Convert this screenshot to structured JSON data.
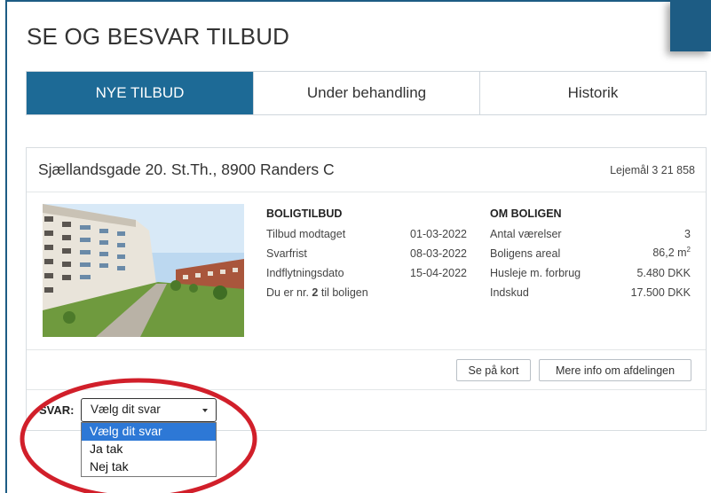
{
  "page": {
    "title": "SE OG BESVAR TILBUD"
  },
  "tabs": [
    {
      "label": "NYE TILBUD",
      "active": true
    },
    {
      "label": "Under behandling",
      "active": false
    },
    {
      "label": "Historik",
      "active": false
    }
  ],
  "offer": {
    "address": "Sjællandsgade 20. St.Th., 8900 Randers C",
    "lease_number": "Lejemål 3 21 858",
    "boligtilbud": {
      "title": "BOLIGTILBUD",
      "rows": [
        {
          "label": "Tilbud modtaget",
          "value": "01-03-2022"
        },
        {
          "label": "Svarfrist",
          "value": "08-03-2022"
        },
        {
          "label": "Indflytningsdato",
          "value": "15-04-2022"
        }
      ],
      "queue_prefix": "Du er nr.",
      "queue_number": "2",
      "queue_suffix": "til boligen"
    },
    "om_boligen": {
      "title": "OM BOLIGEN",
      "rows": [
        {
          "label": "Antal værelser",
          "value": "3"
        },
        {
          "label": "Boligens areal",
          "value": "86,2 m",
          "sup": "2"
        },
        {
          "label": "Husleje m. forbrug",
          "value": "5.480 DKK"
        },
        {
          "label": "Indskud",
          "value": "17.500 DKK"
        }
      ]
    },
    "buttons": {
      "map": "Se på kort",
      "more_info": "Mere info om afdelingen"
    }
  },
  "answer": {
    "label": "SVAR:",
    "selected": "Vælg dit svar",
    "options": [
      "Vælg dit svar",
      "Ja tak",
      "Nej tak"
    ]
  },
  "colors": {
    "primary": "#1d6a96",
    "option_highlight": "#2d78d6",
    "annotation_circle": "#d11f2a"
  }
}
